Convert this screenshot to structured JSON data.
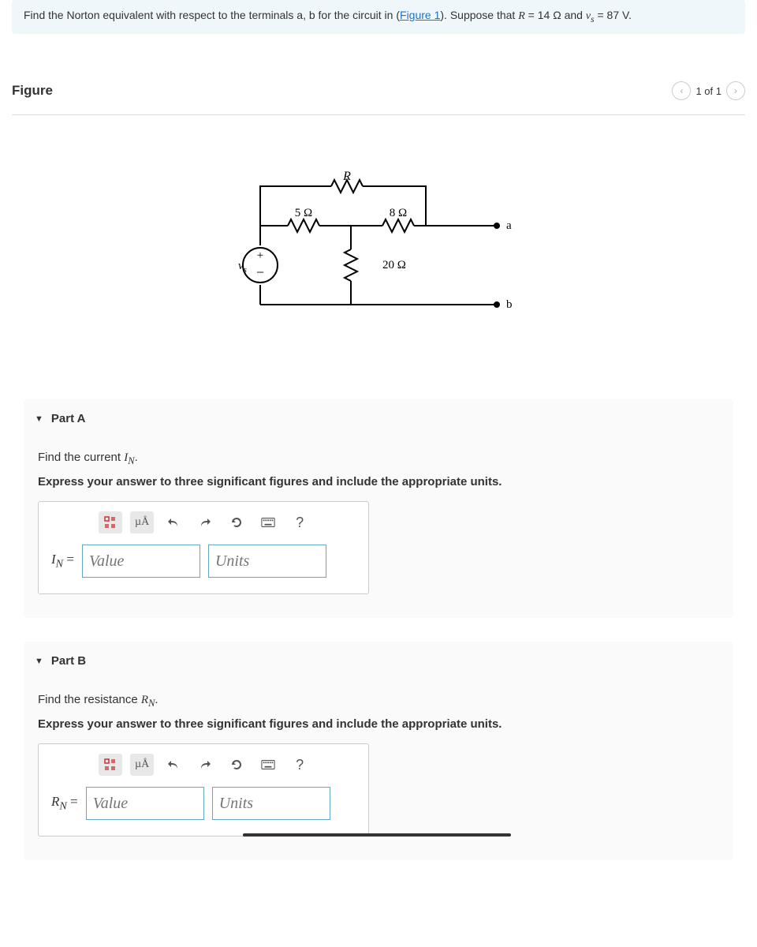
{
  "problem": {
    "pre": "Find the Norton equivalent with respect to the terminals a, b for the circuit in (",
    "figure_link": "Figure 1",
    "post": "). Suppose that ",
    "eq1_lhs": "R",
    "eq1_rhs_val": " = 14 ",
    "eq1_unit": "Ω",
    "and": " and ",
    "eq2_lhs": "v",
    "eq2_sub": "s",
    "eq2_rhs": " = 87 V."
  },
  "figure": {
    "title": "Figure",
    "nav_text": "1 of 1"
  },
  "circuit": {
    "R": "R",
    "r5": "5 Ω",
    "r8": "8 Ω",
    "r20": "20 Ω",
    "vs": "v",
    "vs_sub": "s",
    "node_a": "a",
    "node_b": "b"
  },
  "partA": {
    "title": "Part A",
    "prompt_pre": "Find the current ",
    "prompt_sym": "I",
    "prompt_sub": "N",
    "prompt_post": ".",
    "instruction": "Express your answer to three significant figures and include the appropriate units.",
    "label_sym": "I",
    "label_sub": "N",
    "label_eq": " = ",
    "value_ph": "Value",
    "units_ph": "Units"
  },
  "partB": {
    "title": "Part B",
    "prompt_pre": "Find the resistance ",
    "prompt_sym": "R",
    "prompt_sub": "N",
    "prompt_post": ".",
    "instruction": "Express your answer to three significant figures and include the appropriate units.",
    "label_sym": "R",
    "label_sub": "N",
    "label_eq": " = ",
    "value_ph": "Value",
    "units_ph": "Units"
  },
  "toolbar": {
    "units_btn": "µÅ",
    "help": "?"
  }
}
